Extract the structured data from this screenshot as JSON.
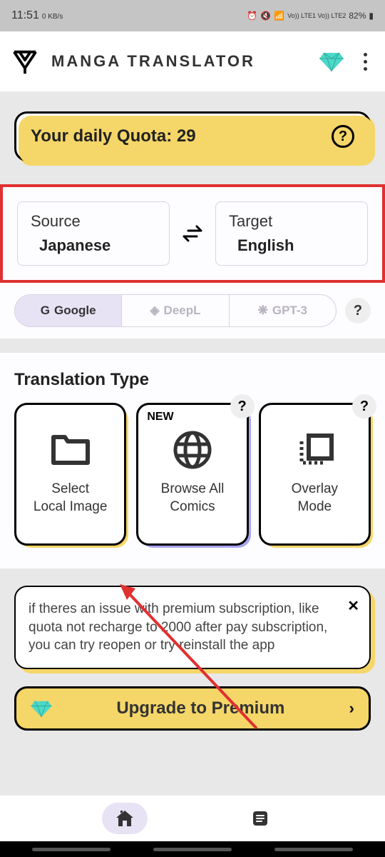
{
  "status_bar": {
    "time": "11:51",
    "speed": "0 KB/s",
    "battery": "82%",
    "network": "Vo)) LTE1 Vo)) LTE2"
  },
  "header": {
    "title": "MANGA TRANSLATOR"
  },
  "quota": {
    "label": "Your daily Quota: 29"
  },
  "languages": {
    "source_label": "Source",
    "source_value": "Japanese",
    "target_label": "Target",
    "target_value": "English"
  },
  "engines": [
    {
      "name": "Google",
      "active": true,
      "prefix": "G"
    },
    {
      "name": "DeepL",
      "active": false,
      "prefix": "◈"
    },
    {
      "name": "GPT-3",
      "active": false,
      "prefix": "❋"
    }
  ],
  "translation_type": {
    "title": "Translation Type",
    "cards": [
      {
        "label": "Select\nLocal Image",
        "badge": "",
        "help": false,
        "shadow": "yellow"
      },
      {
        "label": "Browse All\nComics",
        "badge": "NEW",
        "help": true,
        "shadow": "blue"
      },
      {
        "label": "Overlay\nMode",
        "badge": "",
        "help": true,
        "shadow": "yellow"
      }
    ]
  },
  "notice": {
    "text": "if theres an issue with premium subscription, like quota not recharge to 2000 after pay subscription, you can try reopen or try reinstall the app"
  },
  "premium": {
    "label": "Upgrade to Premium"
  }
}
